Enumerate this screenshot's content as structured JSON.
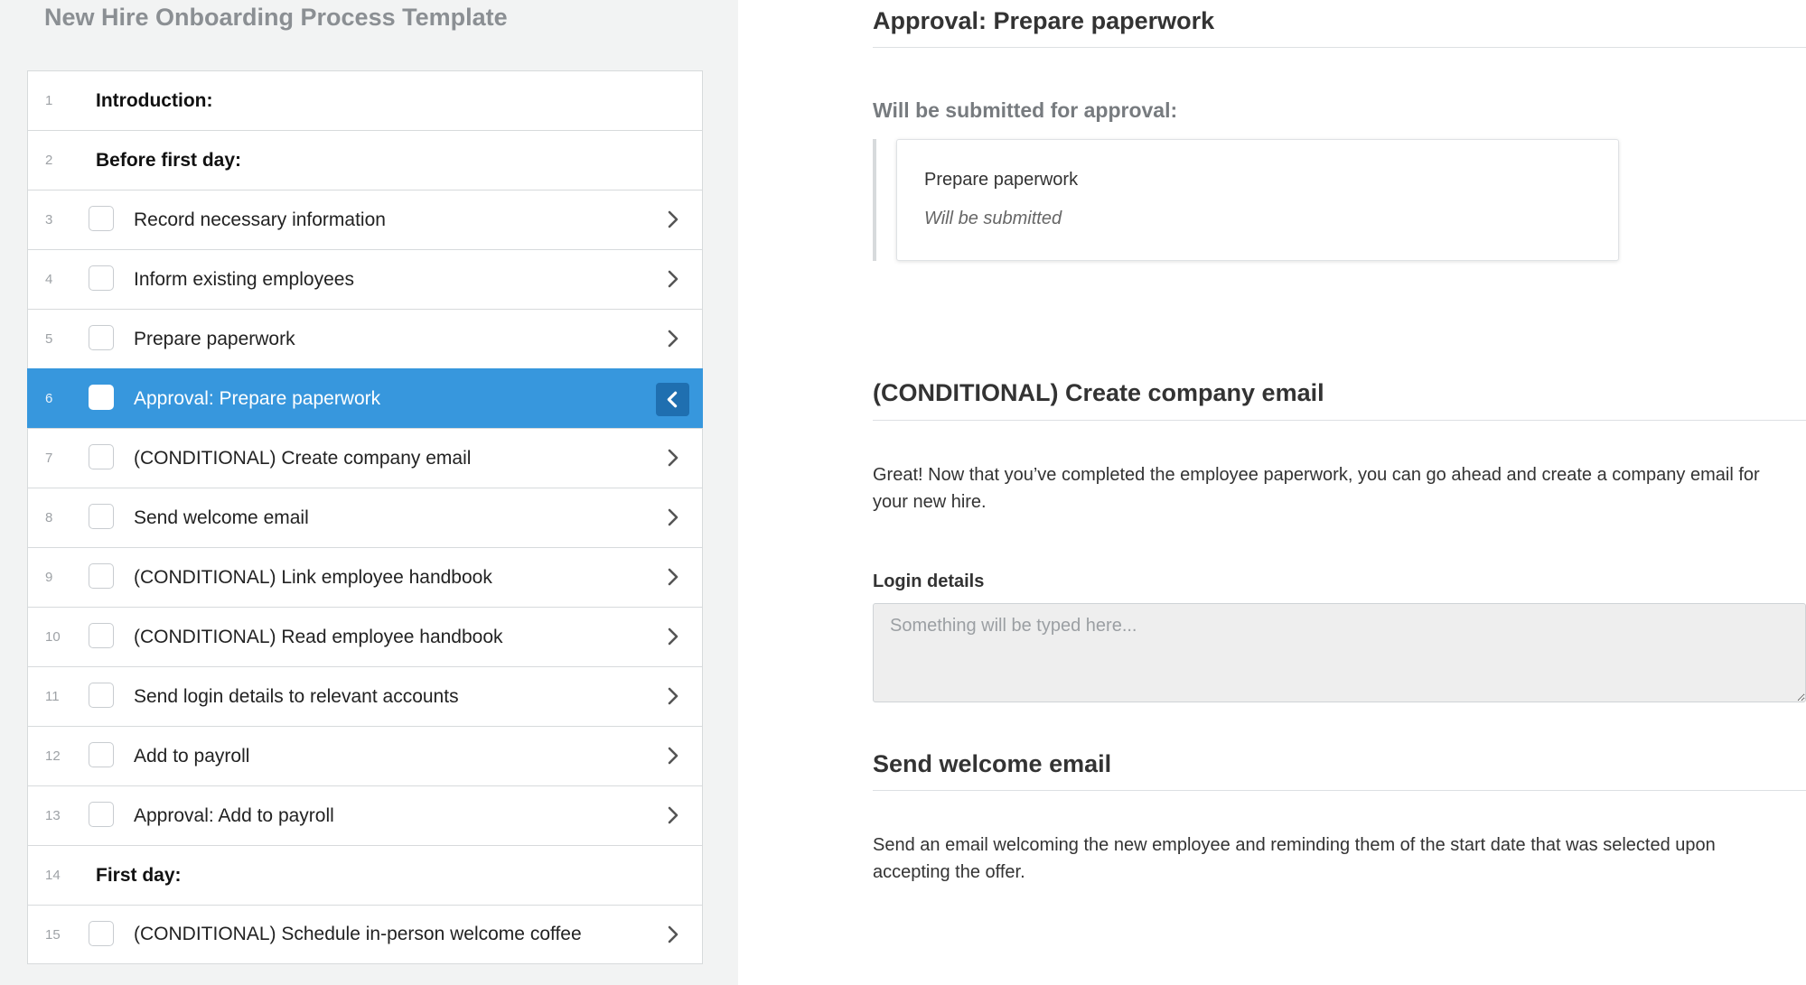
{
  "left": {
    "title": "New Hire Onboarding Process Template",
    "tasks": [
      {
        "num": "1",
        "label": "Introduction:",
        "kind": "section"
      },
      {
        "num": "2",
        "label": "Before first day:",
        "kind": "section"
      },
      {
        "num": "3",
        "label": "Record necessary information",
        "kind": "task"
      },
      {
        "num": "4",
        "label": "Inform existing employees",
        "kind": "task"
      },
      {
        "num": "5",
        "label": "Prepare paperwork",
        "kind": "task"
      },
      {
        "num": "6",
        "label": "Approval: Prepare paperwork",
        "kind": "task",
        "selected": true
      },
      {
        "num": "7",
        "label": "(CONDITIONAL) Create company email",
        "kind": "task"
      },
      {
        "num": "8",
        "label": "Send welcome email",
        "kind": "task"
      },
      {
        "num": "9",
        "label": "(CONDITIONAL) Link employee handbook",
        "kind": "task"
      },
      {
        "num": "10",
        "label": "(CONDITIONAL) Read employee handbook",
        "kind": "task"
      },
      {
        "num": "11",
        "label": "Send login details to relevant accounts",
        "kind": "task"
      },
      {
        "num": "12",
        "label": "Add to payroll",
        "kind": "task"
      },
      {
        "num": "13",
        "label": "Approval: Add to payroll",
        "kind": "task"
      },
      {
        "num": "14",
        "label": "First day:",
        "kind": "section"
      },
      {
        "num": "15",
        "label": "(CONDITIONAL) Schedule in-person welcome coffee",
        "kind": "task"
      }
    ],
    "icons": {
      "row_collapsed": "chevron-right-icon",
      "row_expanded": "chevron-left-icon"
    }
  },
  "right": {
    "approval": {
      "title": "Approval: Prepare paperwork",
      "subheading": "Will be submitted for approval:",
      "card_task": "Prepare paperwork",
      "card_status": "Will be submitted"
    },
    "email_step": {
      "title": "(CONDITIONAL) Create company email",
      "description": "Great! Now that you’ve completed the employee paperwork, you can go ahead and create a company email for your new hire.",
      "field_label": "Login details",
      "field_placeholder": "Something will be typed here..."
    },
    "welcome_step": {
      "title": "Send welcome email",
      "description": "Send an email welcoming the new employee and reminding them of the start date that was selected upon accepting the offer."
    }
  },
  "colors": {
    "selected_row": "#3797dd",
    "selected_chevron_bg": "#1f6fb0",
    "left_background": "#f2f3f3"
  }
}
